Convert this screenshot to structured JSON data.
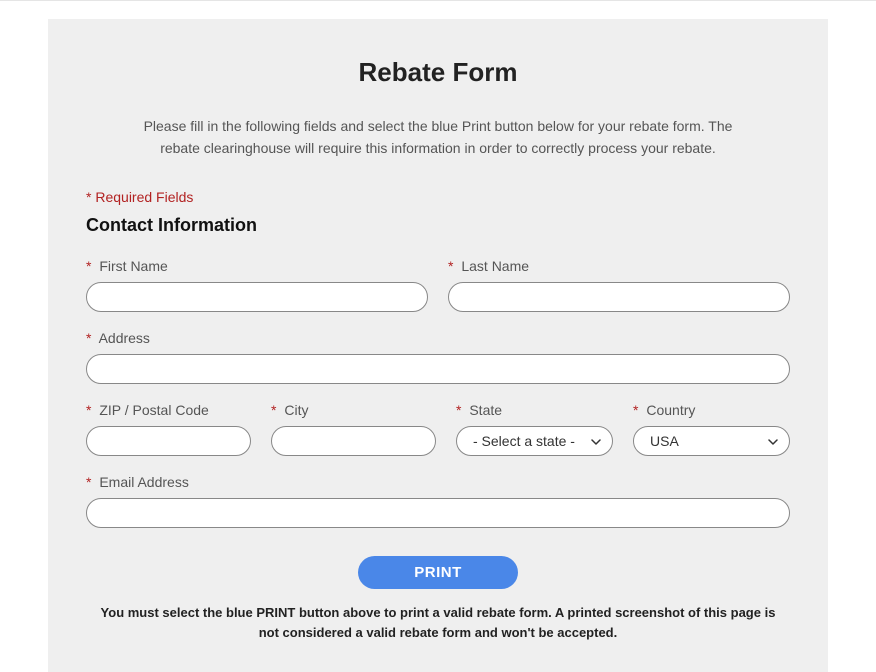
{
  "title": "Rebate Form",
  "intro": "Please fill in the following fields and select the blue Print button below for your rebate form. The rebate clearinghouse will require this information in order to correctly process your rebate.",
  "required_note": "Required Fields",
  "section_heading": "Contact Information",
  "fields": {
    "first_name": {
      "label": "First Name",
      "value": ""
    },
    "last_name": {
      "label": "Last Name",
      "value": ""
    },
    "address": {
      "label": "Address",
      "value": ""
    },
    "zip": {
      "label": "ZIP / Postal Code",
      "value": ""
    },
    "city": {
      "label": "City",
      "value": ""
    },
    "state": {
      "label": "State",
      "placeholder": "- Select a state -",
      "value": ""
    },
    "country": {
      "label": "Country",
      "value": "USA"
    },
    "email": {
      "label": "Email Address",
      "value": ""
    }
  },
  "print_button": "PRINT",
  "disclaimer": "You must select the blue PRINT button above to print a valid rebate form. A printed screenshot of this page is not considered a valid rebate form and won't be accepted."
}
